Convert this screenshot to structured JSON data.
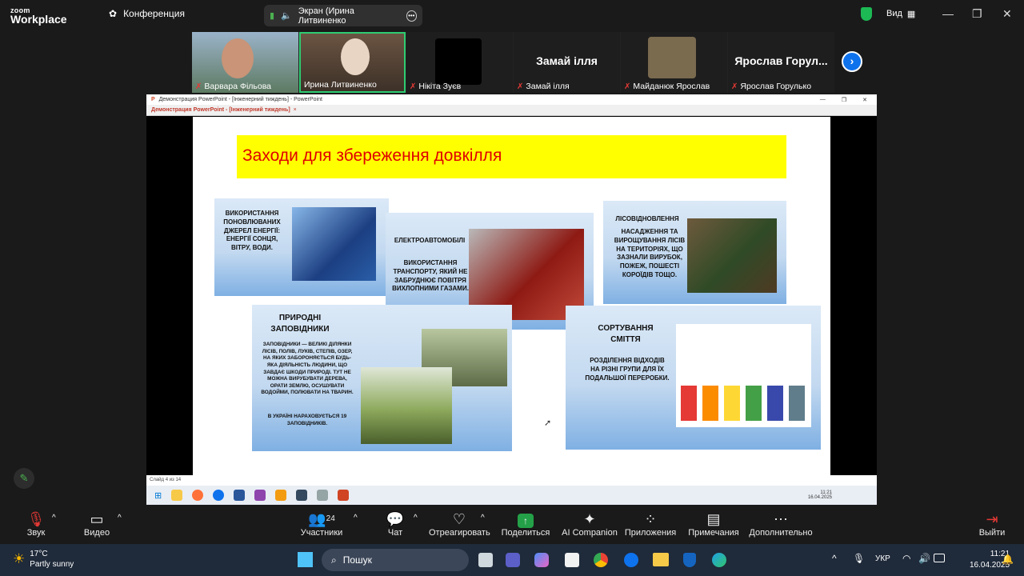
{
  "app": {
    "logo_top": "zoom",
    "logo_bottom": "Workplace",
    "conference_label": "Конференция",
    "share_label": "Экран (Ирина Литвиненко",
    "view_label": "Вид"
  },
  "participants": [
    {
      "name": "Варвара Фільова"
    },
    {
      "name": "Ирина Литвиненко"
    },
    {
      "name": "Нікіта Зуєв"
    },
    {
      "name": "Замай ілля",
      "display": "Замай ілля"
    },
    {
      "name": "Майданюк Ярослав"
    },
    {
      "name": "Ярослав Горулько",
      "display": "Ярослав Горул..."
    }
  ],
  "ppt": {
    "window_title": "Демонстрация PowerPoint - [Інженерний тиждень] - PowerPoint",
    "tab_title": "Демонстрация PowerPoint - [Інженерний тиждень]",
    "status": "Слайд 4 из 14",
    "time": "11:21",
    "date": "16.04.2025",
    "lang": "УКР"
  },
  "slide": {
    "title": "Заходи для збереження довкілля",
    "card1_title": "ВИКОРИСТАННЯ ПОНОВЛЮВАНИХ ДЖЕРЕЛ ЕНЕРГІЇ:",
    "card1_text": "ЕНЕРГІЇ СОНЦЯ, ВІТРУ, ВОДИ.",
    "card2_title": "ЕЛЕКТРОАВТОМОБІЛІ",
    "card2_text": "ВИКОРИСТАННЯ ТРАНСПОРТУ, ЯКИЙ НЕ ЗАБРУДНЮЄ ПОВІТРЯ ВИХЛОПНИМИ ГАЗАМИ.",
    "card3_title": "ЛІСОВІДНОВЛЕННЯ",
    "card3_text": "НАСАДЖЕННЯ ТА ВИРОЩУВАННЯ ЛІСІВ НА ТЕРИТОРІЯХ, ЩО ЗАЗНАЛИ ВИРУБОК, ПОЖЕЖ, ПОШЕСТІ КОРОЇДІВ ТОЩО.",
    "card4_title": "ПРИРОДНІ ЗАПОВІДНИКИ",
    "card4_text": "ЗАПОВІДНИКИ — ВЕЛИКІ ДІЛЯНКИ ЛІСІВ, ПОЛІВ, ЛУКІВ, СТЕПІВ, ОЗЕР, НА ЯКИХ ЗАБОРОНЯЄТЬСЯ БУДЬ-ЯКА ДІЯЛЬНІСТЬ ЛЮДИНИ, ЩО ЗАВДАЄ ШКОДИ ПРИРОДІ. ТУТ НЕ МОЖНА ВИРУБУВАТИ ДЕРЕВА, ОРАТИ ЗЕМЛЮ, ОСУШУВАТИ ВОДОЙМИ, ПОЛЮВАТИ НА ТВАРИН.",
    "card4_text2": "В УКРАЇНІ НАРАХОВУЄТЬСЯ 19 ЗАПОВІДНИКІВ.",
    "card5_title": "СОРТУВАННЯ СМІТТЯ",
    "card5_text": "РОЗДІЛЕННЯ ВІДХОДІВ НА РІЗНІ ГРУПИ ДЛЯ ЇХ ПОДАЛЬШОЇ ПЕРЕРОБКИ."
  },
  "toolbar": {
    "audio": "Звук",
    "video": "Видео",
    "participants": "Участники",
    "participants_count": "24",
    "chat": "Чат",
    "react": "Отреагировать",
    "share": "Поделиться",
    "ai": "AI Companion",
    "apps": "Приложения",
    "notes": "Примечания",
    "more": "Дополнительно",
    "leave": "Выйти"
  },
  "taskbar": {
    "weather_temp": "17°C",
    "weather_desc": "Partly sunny",
    "search": "Пошук",
    "lang": "УКР",
    "time": "11:21",
    "date": "16.04.2025"
  },
  "colors": {
    "zoom_green": "#1db954",
    "share_green": "#24a148",
    "leave_red": "#e53935",
    "title_yellow": "#ffff00",
    "title_red": "#e00000"
  }
}
